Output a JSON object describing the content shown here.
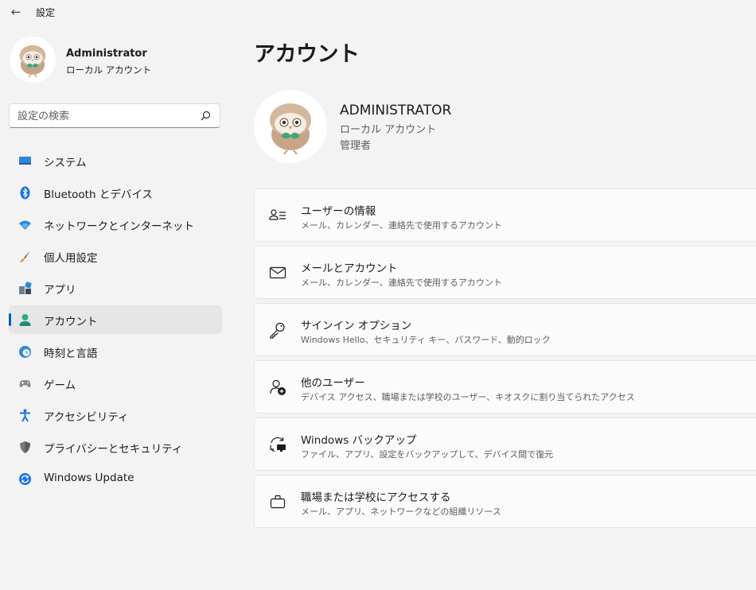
{
  "window": {
    "title": "設定",
    "back_icon": "back-arrow-icon"
  },
  "user": {
    "name": "Administrator",
    "type": "ローカル アカウント"
  },
  "search": {
    "placeholder": "設定の検索",
    "value": ""
  },
  "nav": [
    {
      "label": "システム",
      "icon": "system-display-icon",
      "active": false
    },
    {
      "label": "Bluetooth とデバイス",
      "icon": "bluetooth-icon",
      "active": false
    },
    {
      "label": "ネットワークとインターネット",
      "icon": "wifi-icon",
      "active": false
    },
    {
      "label": "個人用設定",
      "icon": "paintbrush-icon",
      "active": false
    },
    {
      "label": "アプリ",
      "icon": "apps-icon",
      "active": false
    },
    {
      "label": "アカウント",
      "icon": "account-icon",
      "active": true
    },
    {
      "label": "時刻と言語",
      "icon": "time-language-icon",
      "active": false
    },
    {
      "label": "ゲーム",
      "icon": "gamepad-icon",
      "active": false
    },
    {
      "label": "アクセシビリティ",
      "icon": "accessibility-icon",
      "active": false
    },
    {
      "label": "プライバシーとセキュリティ",
      "icon": "shield-icon",
      "active": false
    },
    {
      "label": "Windows Update",
      "icon": "windows-update-icon",
      "active": false
    }
  ],
  "main": {
    "title": "アカウント",
    "header": {
      "name": "ADMINISTRATOR",
      "type": "ローカル アカウント",
      "role": "管理者"
    },
    "cards": [
      {
        "title": "ユーザーの情報",
        "desc": "メール、カレンダー、連絡先で使用するアカウント",
        "icon": "user-info-icon"
      },
      {
        "title": "メールとアカウント",
        "desc": "メール、カレンダー、連絡先で使用するアカウント",
        "icon": "mail-icon"
      },
      {
        "title": "サインイン オプション",
        "desc": "Windows Hello、セキュリティ キー、パスワード、動的ロック",
        "icon": "key-icon"
      },
      {
        "title": "他のユーザー",
        "desc": "デバイス アクセス、職場または学校のユーザー、キオスクに割り当てられたアクセス",
        "icon": "add-user-icon"
      },
      {
        "title": "Windows バックアップ",
        "desc": "ファイル、アプリ、設定をバックアップして、デバイス間で復元",
        "icon": "backup-icon"
      },
      {
        "title": "職場または学校にアクセスする",
        "desc": "メール、アプリ、ネットワークなどの組織リソース",
        "icon": "briefcase-icon"
      }
    ]
  },
  "colors": {
    "accent": "#005fb8",
    "background": "#f3f3f3",
    "card": "#fbfbfb"
  }
}
